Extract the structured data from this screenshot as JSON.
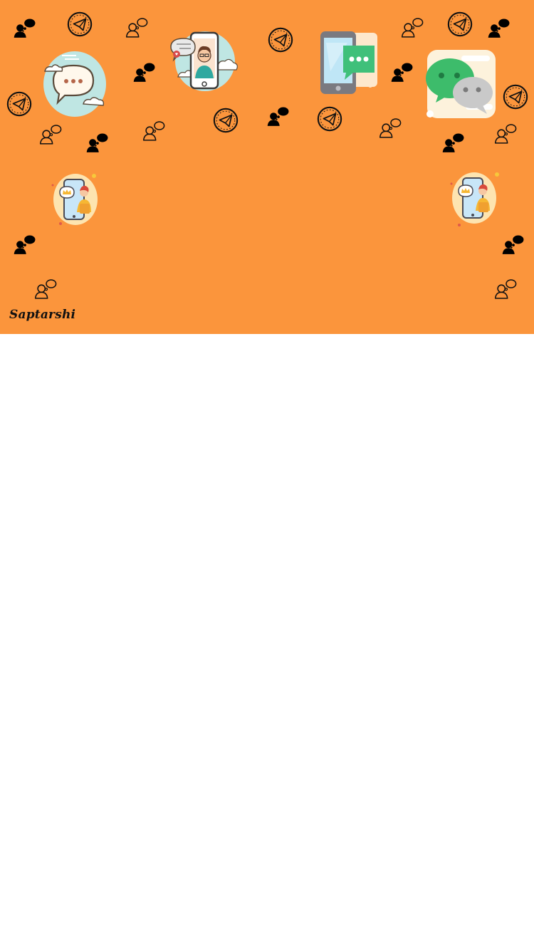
{
  "header": {
    "brand_text": "Saptarshi",
    "background_color": "#fb953c",
    "icons": {
      "telegram": "telegram-circle-icon",
      "person_thought_filled": "person-thought-filled-icon",
      "person_thought_outline": "person-thought-outline-icon",
      "chat_cloud": "chat-bubble-cloud-illustration",
      "phone_avatar": "phone-avatar-chat-illustration",
      "phone_message": "phone-message-illustration",
      "wechat": "wechat-bubbles-illustration",
      "phone_crown": "phone-user-crown-illustration"
    }
  },
  "content": {
    "background_color": "#ffffff"
  }
}
